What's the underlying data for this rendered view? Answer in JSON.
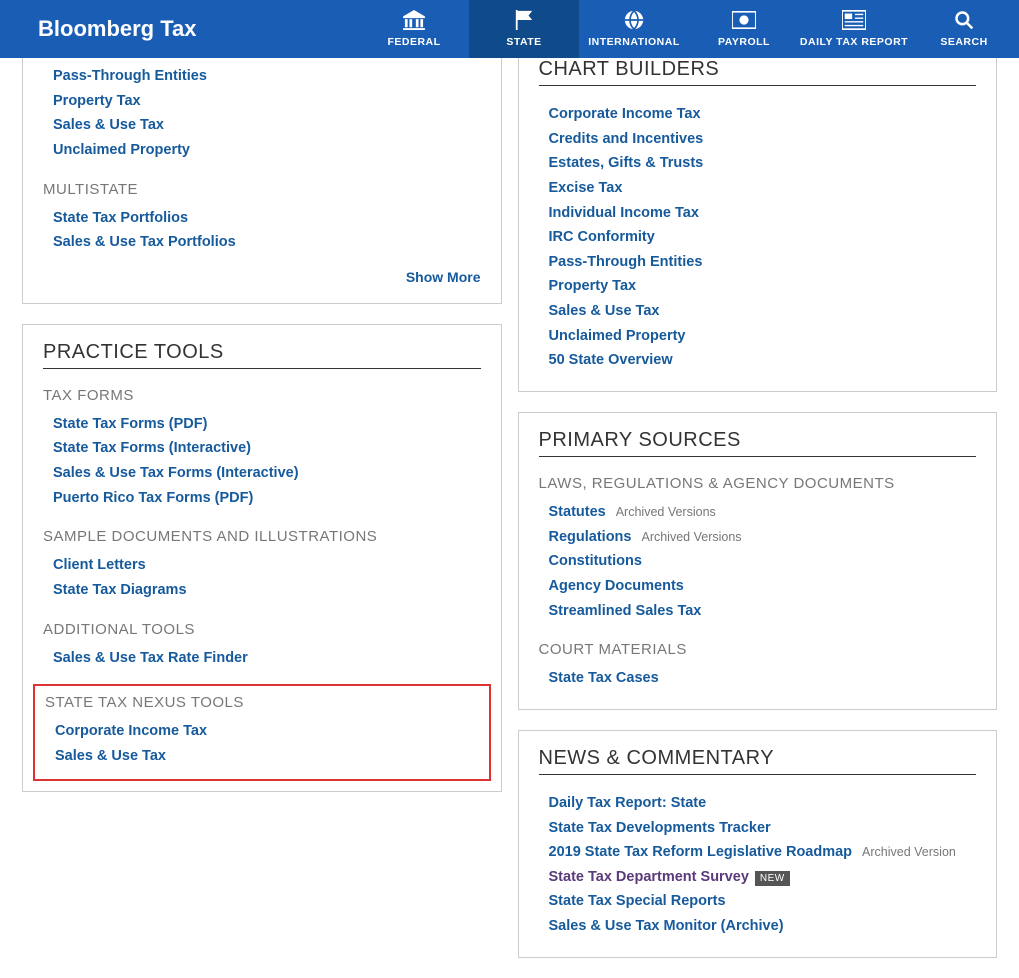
{
  "header": {
    "logo": "Bloomberg Tax",
    "nav": [
      {
        "label": "FEDERAL"
      },
      {
        "label": "STATE"
      },
      {
        "label": "INTERNATIONAL"
      },
      {
        "label": "PAYROLL"
      },
      {
        "label": "DAILY TAX REPORT"
      },
      {
        "label": "SEARCH"
      }
    ]
  },
  "left": {
    "top_panel": {
      "links_top": [
        "Pass-Through Entities",
        "Property Tax",
        "Sales & Use Tax",
        "Unclaimed Property"
      ],
      "multistate_head": "MULTISTATE",
      "multistate_links": [
        "State Tax Portfolios",
        "Sales & Use Tax Portfolios"
      ],
      "show_more": "Show More"
    },
    "practice_tools": {
      "title": "PRACTICE TOOLS",
      "tax_forms_head": "TAX FORMS",
      "tax_forms_links": [
        "State Tax Forms (PDF)",
        "State Tax Forms (Interactive)",
        "Sales & Use Tax Forms (Interactive)",
        "Puerto Rico Tax Forms (PDF)"
      ],
      "samples_head": "SAMPLE DOCUMENTS AND ILLUSTRATIONS",
      "samples_links": [
        "Client Letters",
        "State Tax Diagrams"
      ],
      "additional_head": "ADDITIONAL TOOLS",
      "additional_links": [
        "Sales & Use Tax Rate Finder"
      ],
      "nexus_head": "STATE TAX NEXUS TOOLS",
      "nexus_links": [
        "Corporate Income Tax",
        "Sales & Use Tax"
      ]
    }
  },
  "right": {
    "chart_builders": {
      "title": "CHART BUILDERS",
      "links": [
        "Corporate Income Tax",
        "Credits and Incentives",
        "Estates, Gifts & Trusts",
        "Excise Tax",
        "Individual Income Tax",
        "IRC Conformity",
        "Pass-Through Entities",
        "Property Tax",
        "Sales & Use Tax",
        "Unclaimed Property",
        "50 State Overview"
      ]
    },
    "primary_sources": {
      "title": "PRIMARY SOURCES",
      "laws_head": "LAWS, REGULATIONS & AGENCY DOCUMENTS",
      "statutes": "Statutes",
      "archived": "Archived Versions",
      "regulations": "Regulations",
      "constitutions": "Constitutions",
      "agency": "Agency Documents",
      "streamlined": "Streamlined Sales Tax",
      "court_head": "COURT MATERIALS",
      "cases": "State Tax Cases"
    },
    "news": {
      "title": "NEWS & COMMENTARY",
      "daily": "Daily Tax Report: State",
      "tracker": "State Tax Developments Tracker",
      "roadmap": "2019 State Tax Reform Legislative Roadmap",
      "archived_version": "Archived Version",
      "survey": "State Tax Department Survey",
      "new_badge": "NEW",
      "reports": "State Tax Special Reports",
      "monitor": "Sales & Use Tax Monitor (Archive)"
    }
  }
}
